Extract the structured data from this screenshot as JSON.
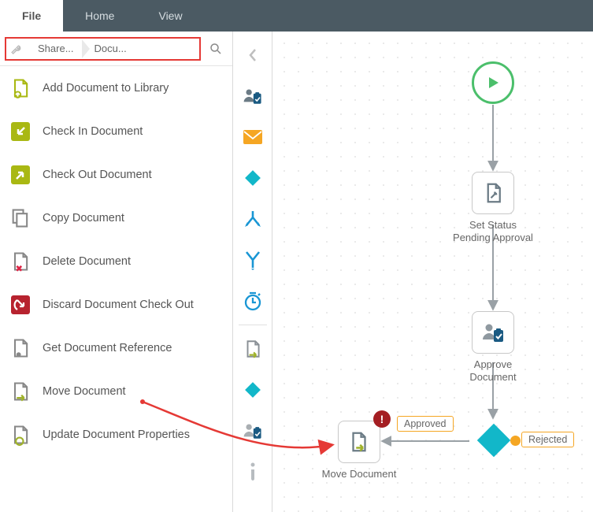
{
  "menu": {
    "tabs": [
      "File",
      "Home",
      "View"
    ],
    "activeIndex": 0
  },
  "breadcrumb": {
    "items": [
      "Share...",
      "Docu..."
    ]
  },
  "actions": [
    {
      "label": "Add Document to Library",
      "icon": "doc-up",
      "color": "#a9b813"
    },
    {
      "label": "Check In Document",
      "icon": "arrow-in",
      "color": "#a9b813"
    },
    {
      "label": "Check Out Document",
      "icon": "arrow-out",
      "color": "#a9b813"
    },
    {
      "label": "Copy Document",
      "icon": "doc-copy",
      "color": "#888"
    },
    {
      "label": "Delete Document",
      "icon": "doc-x",
      "color": "#888"
    },
    {
      "label": "Discard Document Check Out",
      "icon": "discard",
      "color": "#b7232f"
    },
    {
      "label": "Get Document Reference",
      "icon": "doc-ref",
      "color": "#888"
    },
    {
      "label": "Move Document",
      "icon": "doc-move",
      "color": "#888"
    },
    {
      "label": "Update Document Properties",
      "icon": "doc-props",
      "color": "#888"
    }
  ],
  "toolbox": [
    {
      "name": "chevron-left-icon",
      "kind": "chevron",
      "color": "#bfbfbf"
    },
    {
      "name": "clipboard-user-icon",
      "kind": "clip",
      "color": "#6b7b85"
    },
    {
      "name": "envelope-icon",
      "kind": "mail",
      "color": "#f5a623"
    },
    {
      "name": "diamond-icon",
      "kind": "diamond",
      "color": "#12b7c9"
    },
    {
      "name": "split-icon",
      "kind": "split",
      "color": "#1996d4"
    },
    {
      "name": "merge-icon",
      "kind": "merge",
      "color": "#1996d4"
    },
    {
      "name": "timer-icon",
      "kind": "timer",
      "color": "#1996d4"
    },
    {
      "name": "spacer",
      "kind": "sep"
    },
    {
      "name": "doc-go-icon",
      "kind": "docgo",
      "color": "#888"
    },
    {
      "name": "diamond2-icon",
      "kind": "diamond",
      "color": "#12b7c9"
    },
    {
      "name": "clipboard-user2-icon",
      "kind": "clip",
      "color": "#a9aeb2"
    },
    {
      "name": "info-icon",
      "kind": "info",
      "color": "#b7bcc0"
    }
  ],
  "nodes": {
    "start": {
      "label": ""
    },
    "setstatus": {
      "label": "Set Status Pending Approval"
    },
    "approve": {
      "label": "Approve Document"
    },
    "move": {
      "label": "Move Document"
    }
  },
  "badges": {
    "approved": "Approved",
    "rejected": "Rejected"
  }
}
